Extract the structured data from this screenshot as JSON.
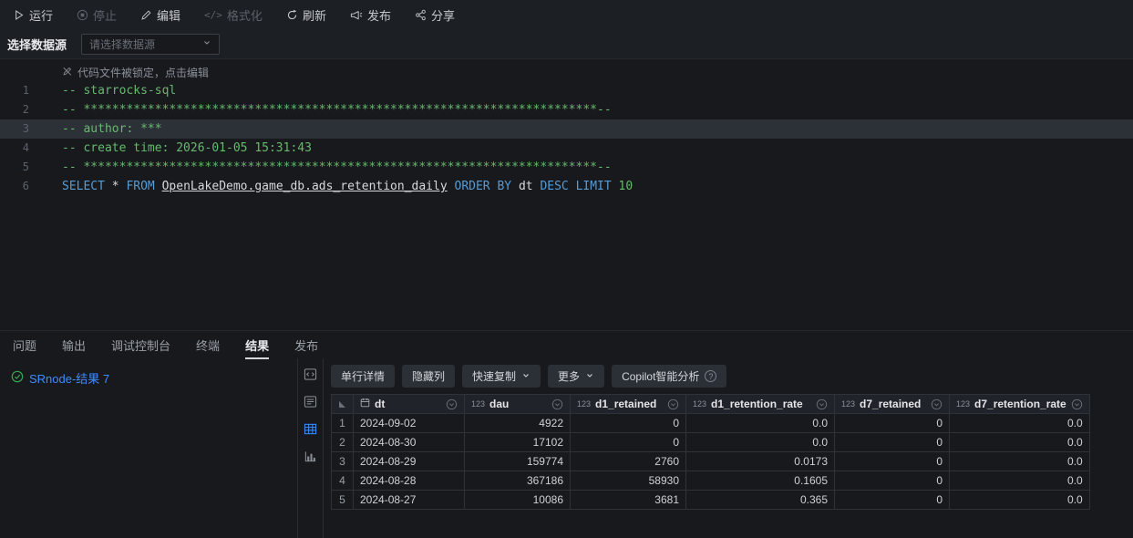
{
  "toolbar": {
    "items": [
      {
        "name": "run",
        "label": "运行",
        "disabled": false
      },
      {
        "name": "stop",
        "label": "停止",
        "disabled": true
      },
      {
        "name": "edit",
        "label": "编辑",
        "disabled": false
      },
      {
        "name": "format",
        "label": "格式化",
        "disabled": true
      },
      {
        "name": "refresh",
        "label": "刷新",
        "disabled": false
      },
      {
        "name": "publish",
        "label": "发布",
        "disabled": false
      },
      {
        "name": "share",
        "label": "分享",
        "disabled": false
      }
    ]
  },
  "datasource": {
    "label": "选择数据源",
    "placeholder": "请选择数据源"
  },
  "editor": {
    "lock_notice": "代码文件被锁定，点击编辑",
    "lines": [
      {
        "no": "1",
        "highlight": false,
        "tokens": [
          {
            "cls": "tok-comment",
            "text": "-- starrocks-sql"
          }
        ]
      },
      {
        "no": "2",
        "highlight": false,
        "tokens": [
          {
            "cls": "tok-comment",
            "text": "-- ************************************************************************--"
          }
        ]
      },
      {
        "no": "3",
        "highlight": true,
        "tokens": [
          {
            "cls": "tok-comment",
            "text": "-- author: ***"
          }
        ]
      },
      {
        "no": "4",
        "highlight": false,
        "tokens": [
          {
            "cls": "tok-comment",
            "text": "-- create time: 2026-01-05 15:31:43"
          }
        ]
      },
      {
        "no": "5",
        "highlight": false,
        "tokens": [
          {
            "cls": "tok-comment",
            "text": "-- ************************************************************************--"
          }
        ]
      },
      {
        "no": "6",
        "highlight": false,
        "tokens": [
          {
            "cls": "tok-keyword",
            "text": "SELECT"
          },
          {
            "cls": "tok-plain",
            "text": " * "
          },
          {
            "cls": "tok-keyword",
            "text": "FROM"
          },
          {
            "cls": "tok-plain",
            "text": " "
          },
          {
            "cls": "tok-table",
            "text": "OpenLakeDemo.game_db.ads_retention_daily"
          },
          {
            "cls": "tok-plain",
            "text": " "
          },
          {
            "cls": "tok-keyword",
            "text": "ORDER BY"
          },
          {
            "cls": "tok-plain",
            "text": " dt "
          },
          {
            "cls": "tok-keyword",
            "text": "DESC"
          },
          {
            "cls": "tok-plain",
            "text": " "
          },
          {
            "cls": "tok-keyword",
            "text": "LIMIT"
          },
          {
            "cls": "tok-plain",
            "text": " "
          },
          {
            "cls": "tok-number",
            "text": "10"
          }
        ]
      }
    ]
  },
  "panel": {
    "tabs": [
      {
        "id": "problems",
        "label": "问题",
        "active": false
      },
      {
        "id": "output",
        "label": "输出",
        "active": false
      },
      {
        "id": "debug-console",
        "label": "调试控制台",
        "active": false
      },
      {
        "id": "terminal",
        "label": "终端",
        "active": false
      },
      {
        "id": "results",
        "label": "结果",
        "active": true
      },
      {
        "id": "publish",
        "label": "发布",
        "active": false
      }
    ],
    "result_link": "SRnode-结果 7"
  },
  "results": {
    "toolbar": [
      {
        "id": "row-detail",
        "label": "单行详情",
        "dropdown": false,
        "help": false
      },
      {
        "id": "hide-columns",
        "label": "隐藏列",
        "dropdown": false,
        "help": false
      },
      {
        "id": "quick-copy",
        "label": "快速复制",
        "dropdown": true,
        "help": false
      },
      {
        "id": "more",
        "label": "更多",
        "dropdown": true,
        "help": false
      },
      {
        "id": "copilot-analysis",
        "label": "Copilot智能分析",
        "dropdown": false,
        "help": true
      }
    ],
    "views": [
      "sql-view",
      "form-view",
      "table-view",
      "chart-view"
    ],
    "active_view": "table-view",
    "table": {
      "columns": [
        {
          "label": "dt",
          "type": "date"
        },
        {
          "label": "dau",
          "type": "number"
        },
        {
          "label": "d1_retained",
          "type": "number"
        },
        {
          "label": "d1_retention_rate",
          "type": "number"
        },
        {
          "label": "d7_retained",
          "type": "number"
        },
        {
          "label": "d7_retention_rate",
          "type": "number"
        }
      ],
      "rows": [
        [
          "2024-09-02",
          "4922",
          "0",
          "0.0",
          "0",
          "0.0"
        ],
        [
          "2024-08-30",
          "17102",
          "0",
          "0.0",
          "0",
          "0.0"
        ],
        [
          "2024-08-29",
          "159774",
          "2760",
          "0.0173",
          "0",
          "0.0"
        ],
        [
          "2024-08-28",
          "367186",
          "58930",
          "0.1605",
          "0",
          "0.0"
        ],
        [
          "2024-08-27",
          "10086",
          "3681",
          "0.365",
          "0",
          "0.0"
        ]
      ]
    }
  },
  "colors": {
    "accent_blue": "#3f8cff",
    "keyword_blue": "#569cd6",
    "comment_green": "#66b96d",
    "check_green": "#33a852"
  }
}
